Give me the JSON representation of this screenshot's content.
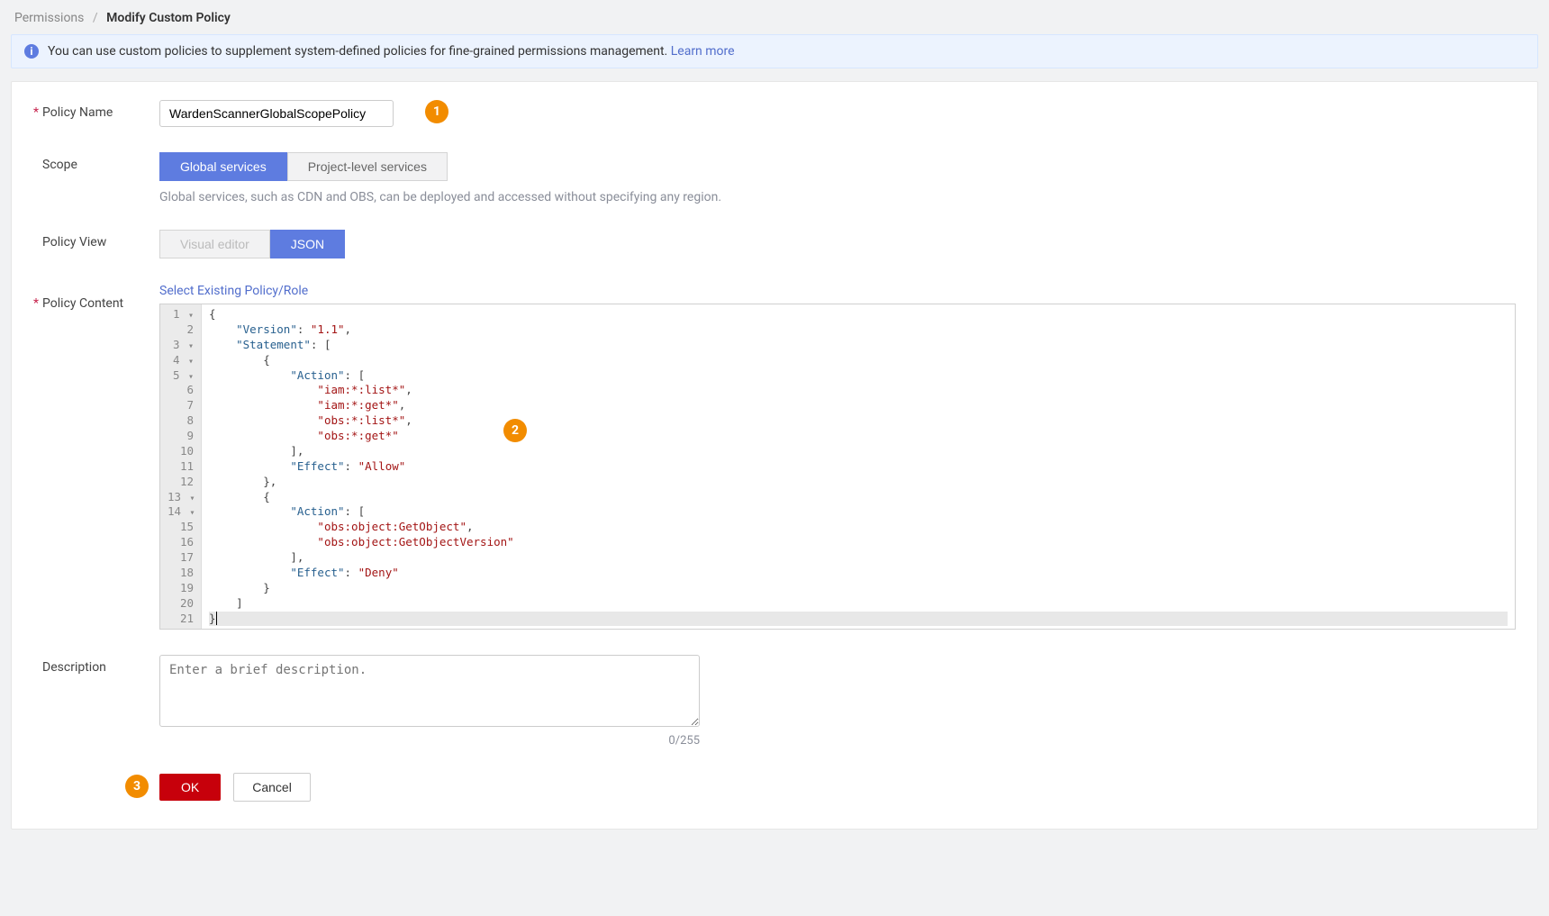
{
  "breadcrumb": {
    "parent": "Permissions",
    "current": "Modify Custom Policy"
  },
  "banner": {
    "text": "You can use custom policies to supplement system-defined policies for fine-grained permissions management.",
    "link": "Learn more"
  },
  "form": {
    "policy_name_label": "Policy Name",
    "policy_name_value": "WardenScannerGlobalScopePolicy",
    "scope_label": "Scope",
    "scope_options": [
      "Global services",
      "Project-level services"
    ],
    "scope_hint": "Global services, such as CDN and OBS, can be deployed and accessed without specifying any region.",
    "view_label": "Policy View",
    "view_options": [
      "Visual editor",
      "JSON"
    ],
    "content_label": "Policy Content",
    "select_existing": "Select Existing Policy/Role",
    "description_label": "Description",
    "description_placeholder": "Enter a brief description.",
    "char_count": "0/255"
  },
  "editor": {
    "line_numbers": [
      "1",
      "2",
      "3",
      "4",
      "5",
      "6",
      "7",
      "8",
      "9",
      "10",
      "11",
      "12",
      "13",
      "14",
      "15",
      "16",
      "17",
      "18",
      "19",
      "20",
      "21"
    ],
    "fold_lines": [
      1,
      3,
      4,
      5,
      13,
      14
    ],
    "json_content": {
      "Version": "1.1",
      "Statement": [
        {
          "Action": [
            "iam:*:list*",
            "iam:*:get*",
            "obs:*:list*",
            "obs:*:get*"
          ],
          "Effect": "Allow"
        },
        {
          "Action": [
            "obs:object:GetObject",
            "obs:object:GetObjectVersion"
          ],
          "Effect": "Deny"
        }
      ]
    }
  },
  "buttons": {
    "ok": "OK",
    "cancel": "Cancel"
  },
  "annotations": {
    "a1": "1",
    "a2": "2",
    "a3": "3"
  }
}
